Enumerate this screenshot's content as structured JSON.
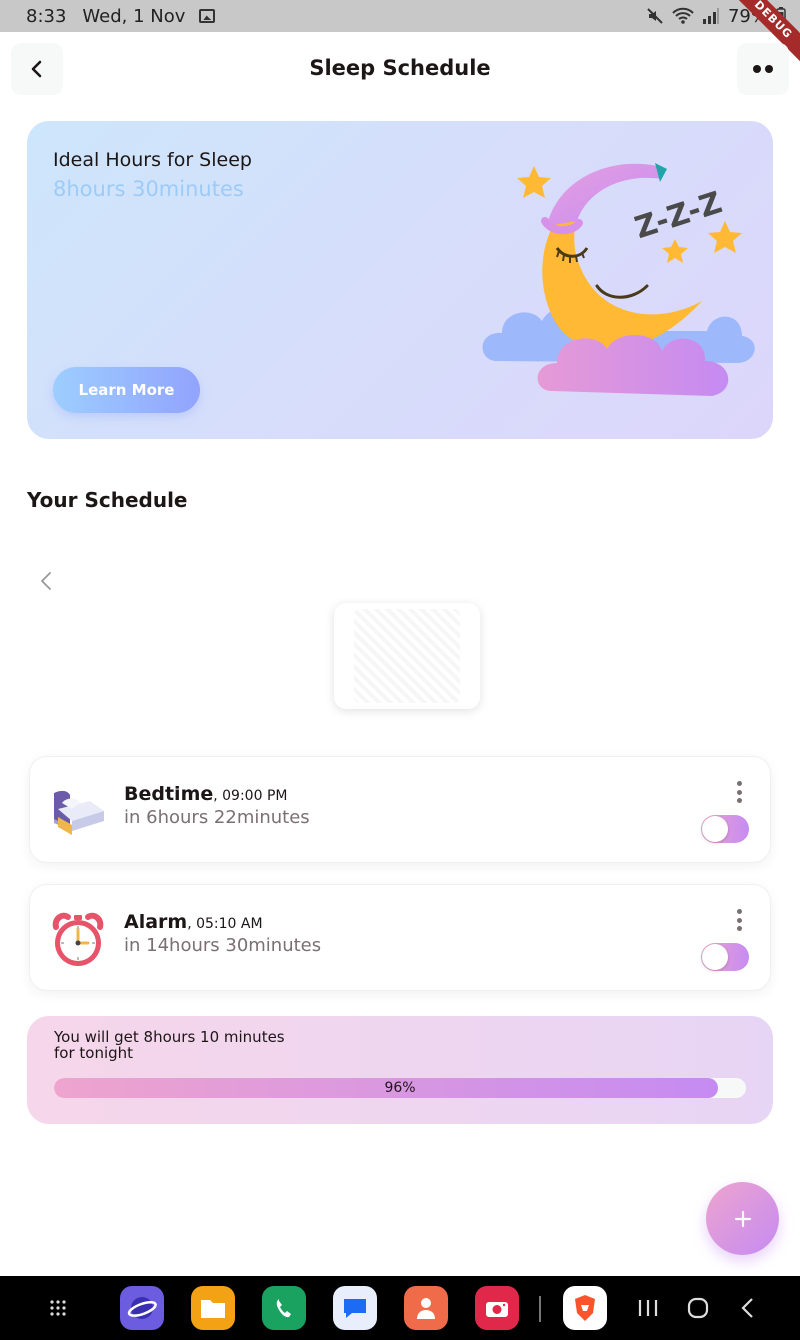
{
  "status_bar": {
    "time": "8:33",
    "date": "Wed, 1 Nov",
    "battery": "79%",
    "debug": "DEBUG"
  },
  "header": {
    "title": "Sleep Schedule"
  },
  "banner": {
    "title": "Ideal Hours for Sleep",
    "value": "8hours 30minutes",
    "button_label": "Learn More",
    "zzz": "Z-Z-Z"
  },
  "schedule": {
    "title": "Your Schedule",
    "items": [
      {
        "name": "Bedtime",
        "time": ", 09:00 PM",
        "subtitle": "in 6hours 22minutes",
        "enabled": true,
        "icon": "bed-icon"
      },
      {
        "name": "Alarm",
        "time": ", 05:10 AM",
        "subtitle": "in 14hours 30minutes",
        "enabled": true,
        "icon": "alarm-clock-icon"
      }
    ]
  },
  "tonight": {
    "line1": "You will get 8hours 10 minutes",
    "line2": "for tonight",
    "progress": 0.96,
    "progress_label": "96%"
  },
  "colors": {
    "primary_blue": "#92A3FD",
    "light_blue": "#9DCEFF",
    "secondary_pink": "#EEA4CE",
    "secondary_purple": "#C58BF2"
  },
  "icons": {
    "back": "chevron-left-icon",
    "more": "two-dots-icon",
    "fab": "plus-icon",
    "navbar": [
      "apps-grid-icon",
      "samsung-internet-icon",
      "my-files-icon",
      "phone-icon",
      "messages-icon",
      "contacts-icon",
      "camera-icon",
      "brave-browser-icon",
      "recents-icon",
      "home-icon",
      "back-icon"
    ]
  }
}
